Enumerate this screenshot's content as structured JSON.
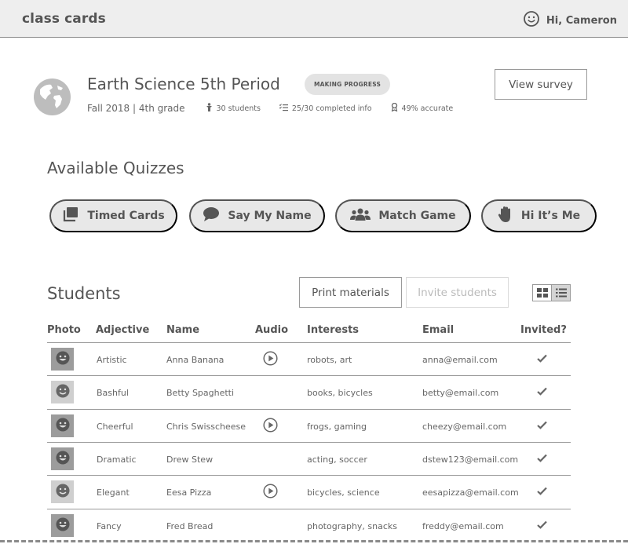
{
  "app": {
    "brand": "class cards",
    "greeting": "Hi, Cameron"
  },
  "class_info": {
    "title": "Earth Science 5th Period",
    "status_badge": "MAKING PROGRESS",
    "term": "Fall 2018 | 4th grade",
    "students_count": "30 students",
    "completed": "25/30 completed info",
    "accuracy": "49% accurate",
    "survey_button": "View survey"
  },
  "quizzes": {
    "title": "Available Quizzes",
    "items": [
      {
        "label": "Timed Cards",
        "icon": "cards-icon"
      },
      {
        "label": "Say My Name",
        "icon": "speech-bubble-icon"
      },
      {
        "label": "Match Game",
        "icon": "group-icon"
      },
      {
        "label": "Hi It’s Me",
        "icon": "hand-icon"
      }
    ]
  },
  "students": {
    "title": "Students",
    "print_button": "Print materials",
    "invite_button": "Invite students",
    "columns": [
      "Photo",
      "Adjective",
      "Name",
      "Audio",
      "Interests",
      "Email",
      "Invited?"
    ],
    "rows": [
      {
        "adjective": "Artistic",
        "name": "Anna Banana",
        "audio": true,
        "interests": "robots, art",
        "email": "anna@email.com",
        "invited": true,
        "photo": "dark"
      },
      {
        "adjective": "Bashful",
        "name": "Betty Spaghetti",
        "audio": false,
        "interests": "books, bicycles",
        "email": "betty@email.com",
        "invited": true,
        "photo": "light"
      },
      {
        "adjective": "Cheerful",
        "name": "Chris Swisscheese",
        "audio": true,
        "interests": "frogs, gaming",
        "email": "cheezy@email.com",
        "invited": true,
        "photo": "dark"
      },
      {
        "adjective": "Dramatic",
        "name": "Drew Stew",
        "audio": false,
        "interests": "acting, soccer",
        "email": "dstew123@email.com",
        "invited": true,
        "photo": "dark"
      },
      {
        "adjective": "Elegant",
        "name": "Eesa Pizza",
        "audio": true,
        "interests": "bicycles, science",
        "email": "eesapizza@email.com",
        "invited": true,
        "photo": "light"
      },
      {
        "adjective": "Fancy",
        "name": "Fred Bread",
        "audio": false,
        "interests": "photography, snacks",
        "email": "freddy@email.com",
        "invited": true,
        "photo": "dark"
      }
    ]
  }
}
